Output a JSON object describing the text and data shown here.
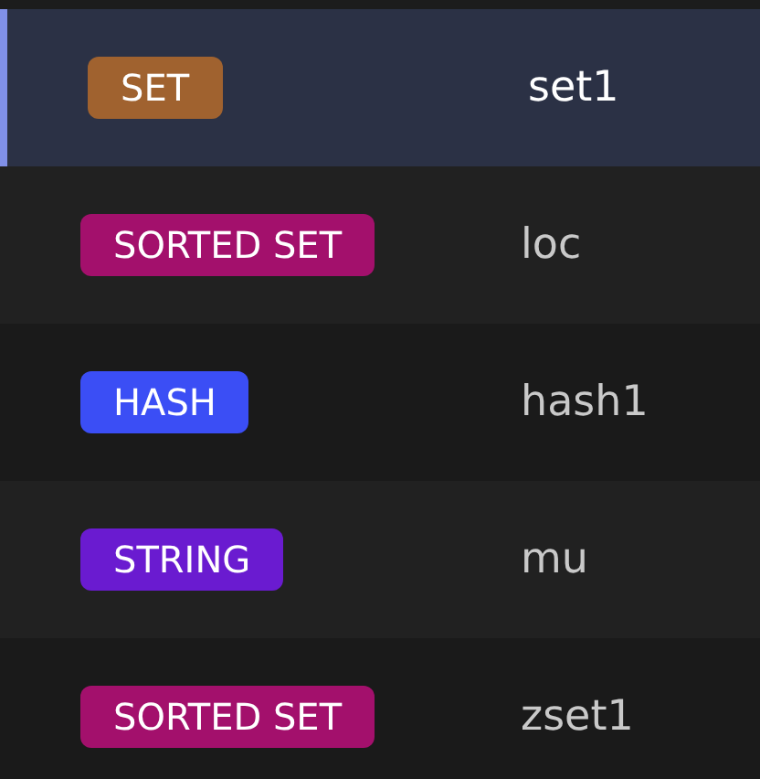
{
  "keys": [
    {
      "type": "SET",
      "color": "#a0622f",
      "name": "set1",
      "selected": true
    },
    {
      "type": "SORTED SET",
      "color": "#a3106c",
      "name": "loc",
      "selected": false
    },
    {
      "type": "HASH",
      "color": "#3b4ef5",
      "name": "hash1",
      "selected": false
    },
    {
      "type": "STRING",
      "color": "#6a1bd0",
      "name": "mu",
      "selected": false
    },
    {
      "type": "SORTED SET",
      "color": "#a3106c",
      "name": "zset1",
      "selected": false
    }
  ]
}
